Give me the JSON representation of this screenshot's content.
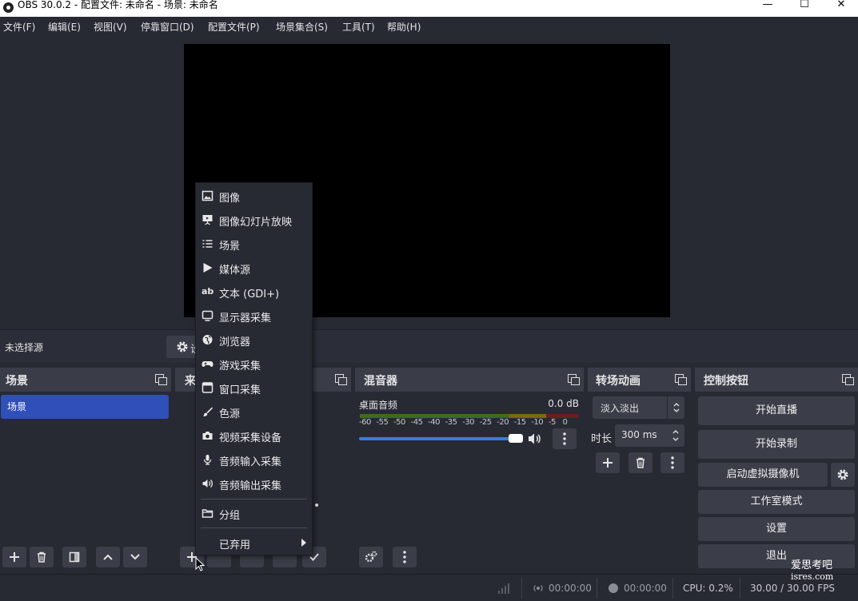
{
  "window": {
    "title": "OBS 30.0.2 - 配置文件: 未命名 - 场景: 未命名",
    "minimize": "—",
    "maximize": "☐",
    "close": "✕"
  },
  "menubar": [
    "文件(F)",
    "编辑(E)",
    "视图(V)",
    "停靠窗口(D)",
    "配置文件(P)",
    "场景集合(S)",
    "工具(T)",
    "帮助(H)"
  ],
  "context_bar": {
    "no_source": "未选择源",
    "props_label": "设"
  },
  "docks": {
    "scenes": {
      "title": "场景",
      "items": [
        "场景"
      ]
    },
    "sources": {
      "title": "来"
    },
    "mixer": {
      "title": "混音器",
      "track_name": "桌面音频",
      "track_level": "0.0 dB",
      "ticks": [
        "-60",
        "-55",
        "-50",
        "-45",
        "-40",
        "-35",
        "-30",
        "-25",
        "-20",
        "-15",
        "-10",
        "-5",
        "0"
      ],
      "volume": 0.92
    },
    "transitions": {
      "title": "转场动画",
      "selected": "淡入淡出",
      "duration_label": "时长",
      "duration_value": "300 ms"
    },
    "controls": {
      "title": "控制按钮",
      "buttons": [
        "开始直播",
        "开始录制",
        "启动虚拟摄像机",
        "工作室模式",
        "设置",
        "退出"
      ]
    }
  },
  "add_source_menu": {
    "items": [
      {
        "label": "图像",
        "icon": "image-icon"
      },
      {
        "label": "图像幻灯片放映",
        "icon": "slideshow-icon"
      },
      {
        "label": "场景",
        "icon": "list-icon"
      },
      {
        "label": "媒体源",
        "icon": "play-icon"
      },
      {
        "label": "文本 (GDI+)",
        "icon": "text-icon"
      },
      {
        "label": "显示器采集",
        "icon": "monitor-icon"
      },
      {
        "label": "浏览器",
        "icon": "globe-icon"
      },
      {
        "label": "游戏采集",
        "icon": "gamepad-icon"
      },
      {
        "label": "窗口采集",
        "icon": "window-icon"
      },
      {
        "label": "色源",
        "icon": "brush-icon"
      },
      {
        "label": "视频采集设备",
        "icon": "camera-icon"
      },
      {
        "label": "音频输入采集",
        "icon": "microphone-icon"
      },
      {
        "label": "音频输出采集",
        "icon": "speaker-icon"
      }
    ],
    "group": {
      "label": "分组",
      "icon": "folder-icon"
    },
    "deprecated": {
      "label": "已弃用",
      "icon": "submenu-arrow-icon"
    }
  },
  "statusbar": {
    "stream_time": "00:00:00",
    "record_time": "00:00:00",
    "cpu": "CPU: 0.2%",
    "fps": "30.00 / 30.00 FPS"
  },
  "watermark": {
    "line1": "爱思考吧",
    "line2": "isres.com"
  }
}
